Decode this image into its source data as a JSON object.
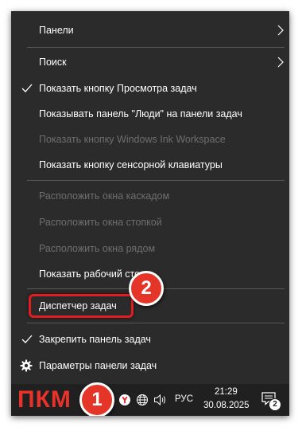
{
  "menu": {
    "items": [
      {
        "label": "Панели"
      },
      {
        "label": "Поиск"
      },
      {
        "label": "Показать кнопку Просмотра задач",
        "checked": true
      },
      {
        "label": "Показывать панель \"Люди\" на панели задач"
      },
      {
        "label": "Показать кнопку Windows Ink Workspace",
        "disabled": true
      },
      {
        "label": "Показать кнопку сенсорной клавиатуры"
      },
      {
        "label": "Расположить окна каскадом",
        "disabled": true
      },
      {
        "label": "Расположить окна стопкой",
        "disabled": true
      },
      {
        "label": "Расположить окна рядом",
        "disabled": true
      },
      {
        "label": "Показать рабочий сто"
      },
      {
        "label": "Диспетчер задач"
      },
      {
        "label": "Закрепить панель задач",
        "checked": true
      },
      {
        "label": "Параметры панели задач"
      }
    ]
  },
  "annotations": {
    "step1": "1",
    "step2": "2",
    "highlight_color": "#e11d1d",
    "badge_color": "#e53528"
  },
  "taskbar": {
    "pkm_label": "ПКМ",
    "language": "РУС",
    "time": "21:29",
    "date": "30.08.2025",
    "notification_count": "2",
    "tray_icons": [
      "yandex-browser-icon",
      "network-globe-icon",
      "volume-icon",
      "action-center-icon"
    ]
  }
}
